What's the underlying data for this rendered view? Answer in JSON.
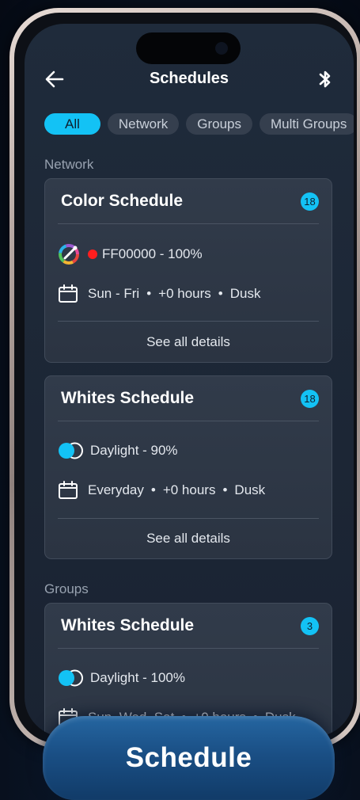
{
  "header": {
    "title": "Schedules",
    "back_icon": "arrow-left-icon",
    "bluetooth_icon": "bluetooth-icon"
  },
  "tabs": [
    {
      "label": "All",
      "active": true
    },
    {
      "label": "Network",
      "active": false
    },
    {
      "label": "Groups",
      "active": false
    },
    {
      "label": "Multi Groups",
      "active": false
    }
  ],
  "sections": {
    "network": "Network",
    "groups": "Groups"
  },
  "cards": [
    {
      "title": "Color Schedule",
      "badge": "18",
      "setting": "FF00000 - 100%",
      "setting_icon": "color-wheel-icon",
      "swatch_color": "#ff1e1e",
      "schedule": {
        "days": "Sun - Fri",
        "offset": "+0 hours",
        "trigger": "Dusk"
      },
      "details_label": "See all details"
    },
    {
      "title": "Whites Schedule",
      "badge": "18",
      "setting": "Daylight - 90%",
      "setting_icon": "toggle-icon",
      "schedule": {
        "days": "Everyday",
        "offset": "+0 hours",
        "trigger": "Dusk"
      },
      "details_label": "See all details"
    },
    {
      "title": "Whites Schedule",
      "badge": "3",
      "setting": "Daylight - 100%",
      "setting_icon": "toggle-icon",
      "schedule": {
        "days": "Sun, Wed, Sat",
        "offset": "+0 hours",
        "trigger": "Dusk"
      }
    }
  ],
  "bottom_button": {
    "label": "Schedule"
  },
  "colors": {
    "accent": "#13c2f5",
    "card_background": "#2f3947",
    "screen_background": "#1e2939",
    "button": "#1a4f85"
  },
  "separator": "•"
}
